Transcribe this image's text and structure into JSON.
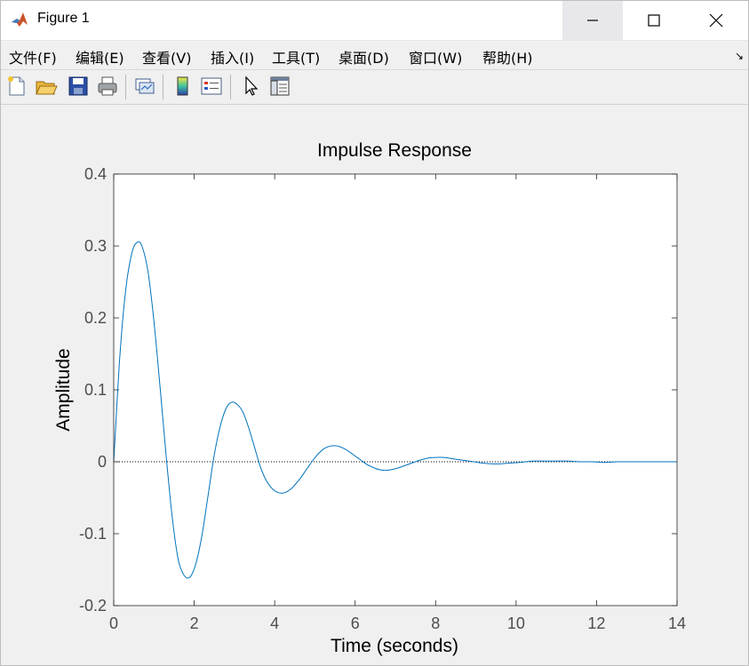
{
  "window": {
    "title": "Figure 1"
  },
  "menu": [
    "文件(F)",
    "编辑(E)",
    "查看(V)",
    "插入(I)",
    "工具(T)",
    "桌面(D)",
    "窗口(W)",
    "帮助(H)"
  ],
  "toolbar": [
    "new-figure",
    "open-file",
    "save-figure",
    "print-figure",
    "link-plot",
    "insert-colorbar",
    "insert-legend",
    "edit-plot",
    "property-editor"
  ],
  "colors": {
    "line": "#0072bd",
    "axes_bg": "#ffffff",
    "figure_bg": "#f0f0f0",
    "text": "#262626",
    "tick": "#4d4d4d"
  },
  "chart_data": {
    "type": "line",
    "title": "Impulse Response",
    "xlabel": "Time (seconds)",
    "ylabel": "Amplitude",
    "xlim": [
      0,
      14
    ],
    "ylim": [
      -0.2,
      0.4
    ],
    "xticks": [
      0,
      2,
      4,
      6,
      8,
      10,
      12,
      14
    ],
    "yticks": [
      -0.2,
      -0.1,
      0,
      0.1,
      0.2,
      0.3,
      0.4
    ],
    "xtick_labels": [
      "0",
      "2",
      "4",
      "6",
      "8",
      "10",
      "12",
      "14"
    ],
    "ytick_labels": [
      "-0.2",
      "-0.1",
      "0",
      "0.1",
      "0.2",
      "0.3",
      "0.4"
    ],
    "grid": false,
    "zero_line": "dotted",
    "series": [
      {
        "x": [
          0,
          0.15,
          0.3,
          0.45,
          0.58,
          0.7,
          0.85,
          1.0,
          1.15,
          1.3,
          1.45,
          1.6,
          1.75,
          1.9,
          2.05,
          2.2,
          2.35,
          2.5,
          2.65,
          2.8,
          2.95,
          3.1,
          3.22,
          3.35,
          3.5,
          3.65,
          3.8,
          3.95,
          4.1,
          4.25,
          4.4,
          4.52,
          4.65,
          4.8,
          4.95,
          5.1,
          5.25,
          5.4,
          5.55,
          5.7,
          5.85,
          6.0,
          6.15,
          6.3,
          6.45,
          6.6,
          6.75,
          6.9,
          7.05,
          7.2,
          7.4,
          7.6,
          7.8,
          8.0,
          8.2,
          8.45,
          8.7,
          8.95,
          9.2,
          9.5,
          9.8,
          10.1,
          10.4,
          10.7,
          11.0,
          11.3,
          11.6,
          11.9,
          12.2,
          12.5,
          12.8,
          13.1,
          13.4,
          13.7,
          14.0
        ],
        "y": [
          0,
          0.145,
          0.24,
          0.29,
          0.305,
          0.3,
          0.265,
          0.195,
          0.105,
          0.01,
          -0.075,
          -0.135,
          -0.158,
          -0.16,
          -0.14,
          -0.1,
          -0.045,
          0.01,
          0.05,
          0.075,
          0.083,
          0.078,
          0.068,
          0.048,
          0.02,
          -0.008,
          -0.027,
          -0.038,
          -0.043,
          -0.043,
          -0.038,
          -0.031,
          -0.022,
          -0.01,
          0.002,
          0.012,
          0.019,
          0.022,
          0.022,
          0.019,
          0.014,
          0.008,
          0.002,
          -0.004,
          -0.008,
          -0.011,
          -0.012,
          -0.011,
          -0.009,
          -0.006,
          -0.002,
          0.002,
          0.005,
          0.006,
          0.006,
          0.004,
          0.002,
          0,
          -0.002,
          -0.003,
          -0.002,
          -0.001,
          0.001,
          0.001,
          0.001,
          0.001,
          0,
          0,
          -0.001,
          0,
          0,
          0,
          0,
          0,
          0
        ]
      }
    ]
  }
}
